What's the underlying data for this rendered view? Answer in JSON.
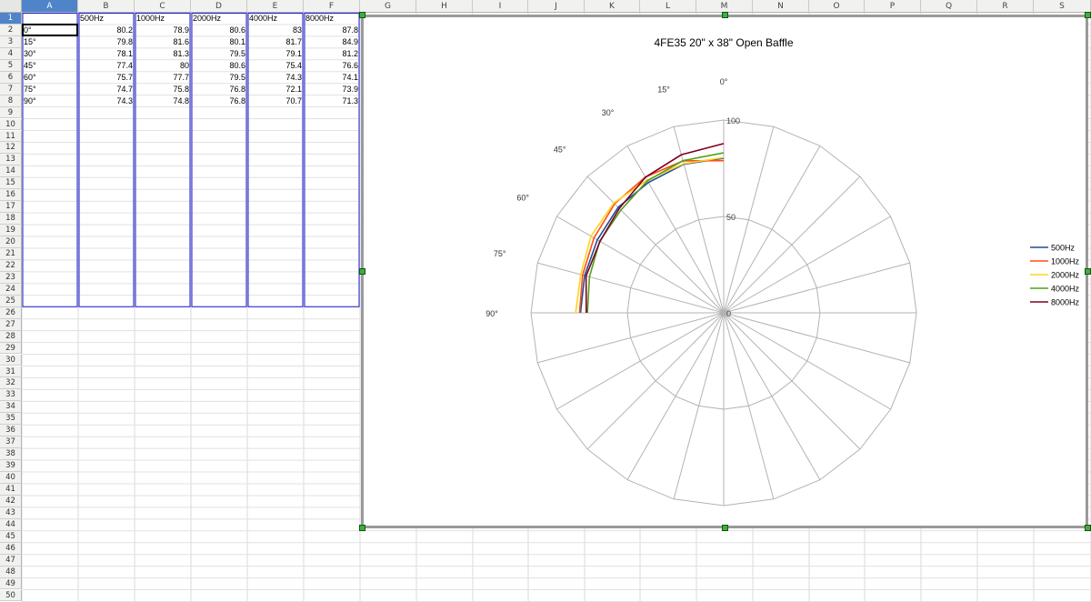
{
  "columns": [
    "A",
    "B",
    "C",
    "D",
    "E",
    "F",
    "G",
    "H",
    "I",
    "J",
    "K",
    "L",
    "M",
    "N",
    "O",
    "P",
    "Q",
    "R",
    "S"
  ],
  "rows": [
    "1",
    "2",
    "3",
    "4",
    "5",
    "6",
    "7",
    "8",
    "9",
    "10",
    "11",
    "12",
    "13",
    "14",
    "15",
    "16",
    "17",
    "18",
    "19",
    "20",
    "21",
    "22",
    "23",
    "24",
    "25",
    "26",
    "27",
    "28",
    "29",
    "30",
    "31",
    "32",
    "33",
    "34",
    "35",
    "36",
    "37",
    "38",
    "39",
    "40",
    "41",
    "42",
    "43",
    "44",
    "45",
    "46",
    "47",
    "48",
    "49",
    "50"
  ],
  "table": {
    "headers": [
      "",
      "500Hz",
      "1000Hz",
      "2000Hz",
      "4000Hz",
      "8000Hz"
    ],
    "rows": [
      [
        "0°",
        "80.2",
        "78.9",
        "80.6",
        "83",
        "87.8"
      ],
      [
        "15°",
        "79.8",
        "81.6",
        "80.1",
        "81.7",
        "84.9"
      ],
      [
        "30°",
        "78.1",
        "81.3",
        "79.5",
        "79.1",
        "81.2"
      ],
      [
        "45°",
        "77.4",
        "80",
        "80.6",
        "75.4",
        "76.6"
      ],
      [
        "60°",
        "75.7",
        "77.7",
        "79.5",
        "74.3",
        "74.1"
      ],
      [
        "75°",
        "74.7",
        "75.8",
        "76.8",
        "72.1",
        "73.9"
      ],
      [
        "90°",
        "74.3",
        "74.8",
        "76.8",
        "70.7",
        "71.3"
      ]
    ]
  },
  "chart_data": {
    "type": "line",
    "subtype": "polar",
    "title": "4FE35 20\" x 38\" Open Baffle",
    "angle_labels": [
      "0°",
      "15°",
      "30°",
      "45°",
      "60°",
      "75°",
      "90°"
    ],
    "angles": [
      0,
      15,
      30,
      45,
      60,
      75,
      90
    ],
    "radial_ticks": [
      "0",
      "50",
      "100"
    ],
    "rlim": [
      0,
      100
    ],
    "grid": true,
    "legend_position": "right",
    "series": [
      {
        "name": "500Hz",
        "color": "#1f4e99",
        "values": [
          80.2,
          79.8,
          78.1,
          77.4,
          75.7,
          74.7,
          74.3
        ]
      },
      {
        "name": "1000Hz",
        "color": "#ff4e12",
        "values": [
          78.9,
          81.6,
          81.3,
          80,
          77.7,
          75.8,
          74.8
        ]
      },
      {
        "name": "2000Hz",
        "color": "#ffd320",
        "values": [
          80.6,
          80.1,
          79.5,
          80.6,
          79.5,
          76.8,
          76.8
        ]
      },
      {
        "name": "4000Hz",
        "color": "#579d1c",
        "values": [
          83,
          81.7,
          79.1,
          75.4,
          74.3,
          72.1,
          70.7
        ]
      },
      {
        "name": "8000Hz",
        "color": "#7e0021",
        "values": [
          87.8,
          84.9,
          81.2,
          76.6,
          74.1,
          73.9,
          71.3
        ]
      }
    ]
  }
}
